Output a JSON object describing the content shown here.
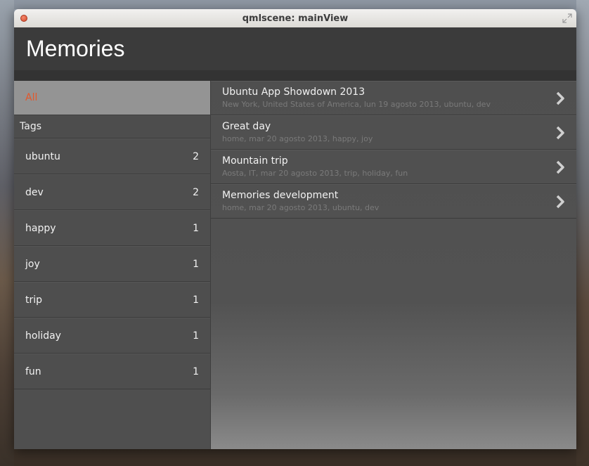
{
  "window": {
    "title": "qmlscene: mainView"
  },
  "header": {
    "title": "Memories"
  },
  "sidebar": {
    "all_label": "All",
    "tags_heading": "Tags",
    "tags": [
      {
        "label": "ubuntu",
        "count": "2"
      },
      {
        "label": "dev",
        "count": "2"
      },
      {
        "label": "happy",
        "count": "1"
      },
      {
        "label": "joy",
        "count": "1"
      },
      {
        "label": "trip",
        "count": "1"
      },
      {
        "label": "holiday",
        "count": "1"
      },
      {
        "label": "fun",
        "count": "1"
      }
    ]
  },
  "memories": [
    {
      "title": "Ubuntu App Showdown 2013",
      "subtitle": "New York, United States of America, lun 19 agosto 2013, ubuntu, dev"
    },
    {
      "title": "Great day",
      "subtitle": "home, mar 20 agosto 2013, happy, joy"
    },
    {
      "title": "Mountain trip",
      "subtitle": "Aosta, IT, mar 20 agosto 2013, trip, holiday, fun"
    },
    {
      "title": "Memories development",
      "subtitle": "home, mar 20 agosto 2013, ubuntu, dev"
    }
  ],
  "colors": {
    "accent": "#e4572a",
    "header_bg": "#3b3b3b",
    "selected_bg": "#949494"
  },
  "icons": {
    "close": "close-icon",
    "maximize": "maximize-icon",
    "chevron": "chevron-right-icon"
  }
}
